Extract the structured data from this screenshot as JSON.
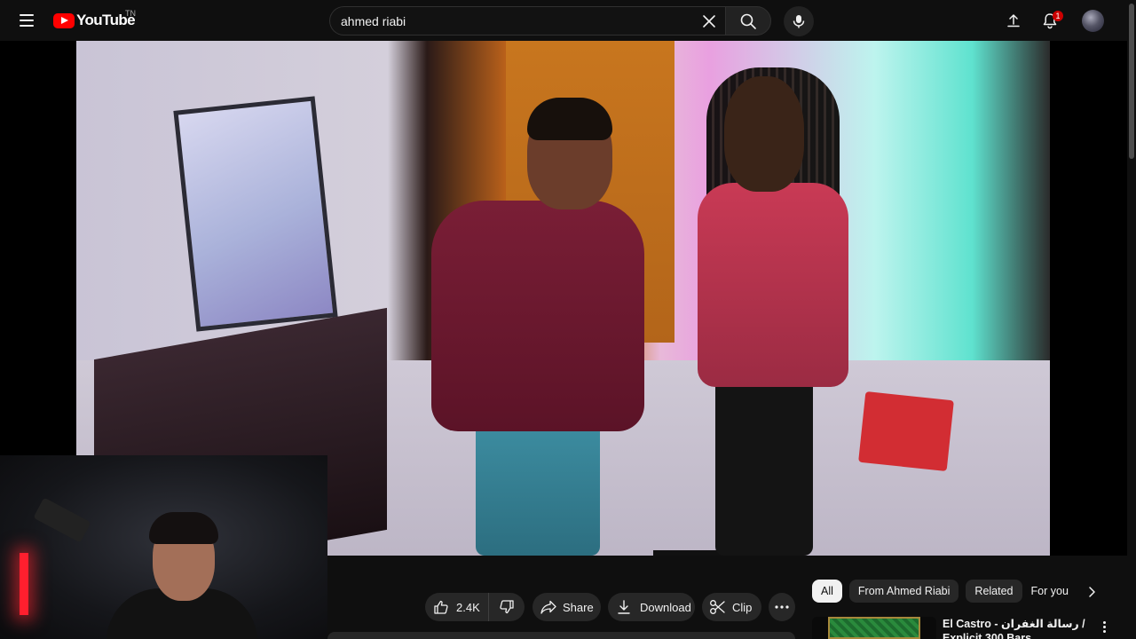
{
  "header": {
    "logo_text": "YouTube",
    "country_code": "TN",
    "search_value": "ahmed riabi",
    "notification_count": "1",
    "icons": [
      "menu-icon",
      "search-icon",
      "close-icon",
      "mic-icon",
      "upload-icon",
      "bell-icon",
      "avatar"
    ]
  },
  "video": {
    "like_count": "2.4K"
  },
  "actions": {
    "share_label": "Share",
    "download_label": "Download",
    "clip_label": "Clip"
  },
  "chips": [
    "All",
    "From Ahmed Riabi",
    "Related",
    "For you"
  ],
  "recommendation": {
    "title": "El Castro - رسالة الغفران / Explicit 300 Bars"
  },
  "colors": {
    "background": "#0f0f0f",
    "brand_red": "#ff0000",
    "pill": "#272727",
    "active_chip": "#f1f1f1"
  }
}
